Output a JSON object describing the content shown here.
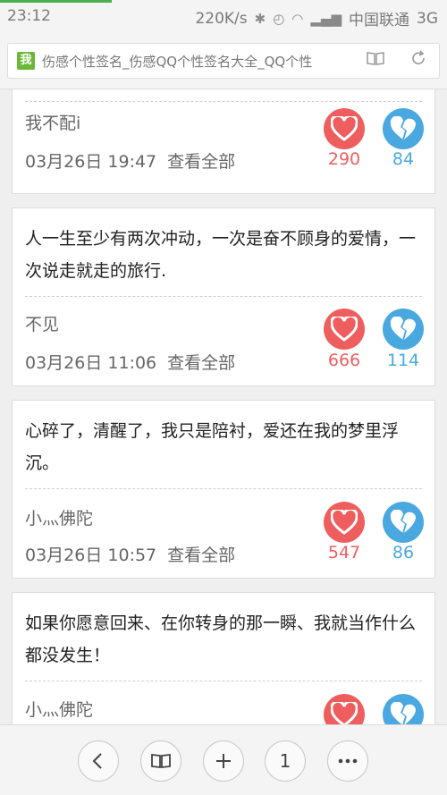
{
  "status_bar": {
    "time": "23:12",
    "speed": "220K/s",
    "carrier": "中国联通",
    "network": "3G"
  },
  "url_bar": {
    "favicon_text": "我",
    "title": "伤感个性签名_伤感QQ个性签名大全_QQ个性",
    "read_icon": "book-icon",
    "refresh_icon": "refresh-icon"
  },
  "posts": [
    {
      "text": "",
      "author": "我不配i",
      "date": "03月26日 19:47",
      "view_all": "查看全部",
      "likes": "290",
      "breaks": "84"
    },
    {
      "text": "人一生至少有两次冲动，一次是奋不顾身的爱情，一次说走就走的旅行.",
      "author": "不见",
      "date": "03月26日 11:06",
      "view_all": "查看全部",
      "likes": "666",
      "breaks": "114"
    },
    {
      "text": "心碎了，清醒了，我只是陪衬，爱还在我的梦里浮沉。",
      "author": "小灬佛陀",
      "date": "03月26日 10:57",
      "view_all": "查看全部",
      "likes": "547",
      "breaks": "86"
    },
    {
      "text": "如果你愿意回来、在你转身的那一瞬、我就当作什么都没发生！",
      "author": "小灬佛陀",
      "date": "",
      "view_all": "",
      "likes": "",
      "breaks": ""
    }
  ],
  "bottom_nav": {
    "back_icon": "back-icon",
    "bookmarks_icon": "book-icon",
    "add_icon": "plus-icon",
    "tabs_count": "1",
    "menu_icon": "more-icon"
  },
  "colors": {
    "like": "#ef5e5e",
    "break": "#4aa8e0",
    "favicon": "#6bb839"
  }
}
